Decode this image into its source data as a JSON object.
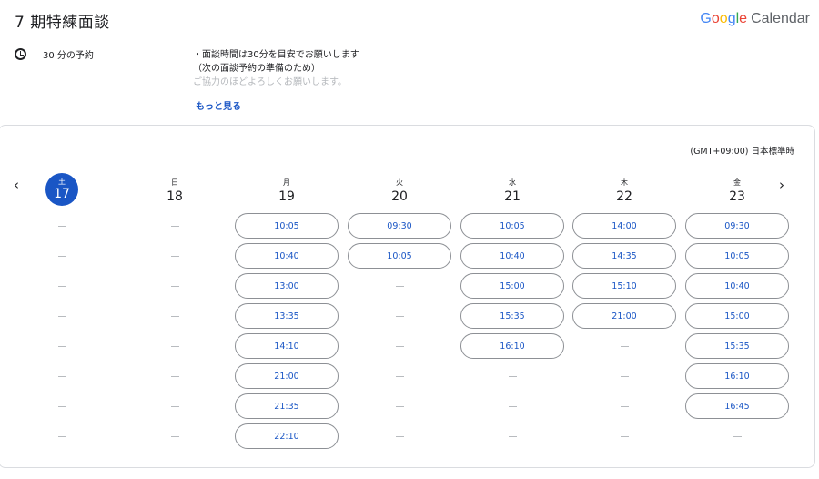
{
  "header": {
    "title": "7 期特練面談",
    "brand": {
      "google": [
        {
          "ch": "G",
          "color": "#4285F4"
        },
        {
          "ch": "o",
          "color": "#EA4335"
        },
        {
          "ch": "o",
          "color": "#FBBC05"
        },
        {
          "ch": "g",
          "color": "#4285F4"
        },
        {
          "ch": "l",
          "color": "#34A853"
        },
        {
          "ch": "e",
          "color": "#EA4335"
        }
      ],
      "product": "Calendar"
    }
  },
  "info": {
    "duration": "30 分の予約",
    "description_lines": [
      "・面談時間は30分を目安でお願いします",
      "（次の面談予約の準備のため）",
      "ご協力のほどよろしくお願いします。"
    ],
    "more_link": "もっと見る"
  },
  "calendar": {
    "timezone": "(GMT+09:00) 日本標準時",
    "colors": {
      "accent": "#1a56c5",
      "today_bg": "#1a56c5"
    },
    "days": [
      {
        "dow": "土",
        "num": "17",
        "today": true,
        "slots": []
      },
      {
        "dow": "日",
        "num": "18",
        "today": false,
        "slots": []
      },
      {
        "dow": "月",
        "num": "19",
        "today": false,
        "slots": [
          "10:05",
          "10:40",
          "13:00",
          "13:35",
          "14:10",
          "21:00",
          "21:35",
          "22:10"
        ]
      },
      {
        "dow": "火",
        "num": "20",
        "today": false,
        "slots": [
          "09:30",
          "10:05"
        ]
      },
      {
        "dow": "水",
        "num": "21",
        "today": false,
        "slots": [
          "10:05",
          "10:40",
          "15:00",
          "15:35",
          "16:10"
        ]
      },
      {
        "dow": "木",
        "num": "22",
        "today": false,
        "slots": [
          "14:00",
          "14:35",
          "15:10",
          "21:00"
        ]
      },
      {
        "dow": "金",
        "num": "23",
        "today": false,
        "slots": [
          "09:30",
          "10:05",
          "10:40",
          "15:00",
          "15:35",
          "16:10",
          "16:45"
        ]
      }
    ],
    "rows": 8,
    "prev_icon": "chevron-left-icon",
    "next_icon": "chevron-right-icon"
  }
}
